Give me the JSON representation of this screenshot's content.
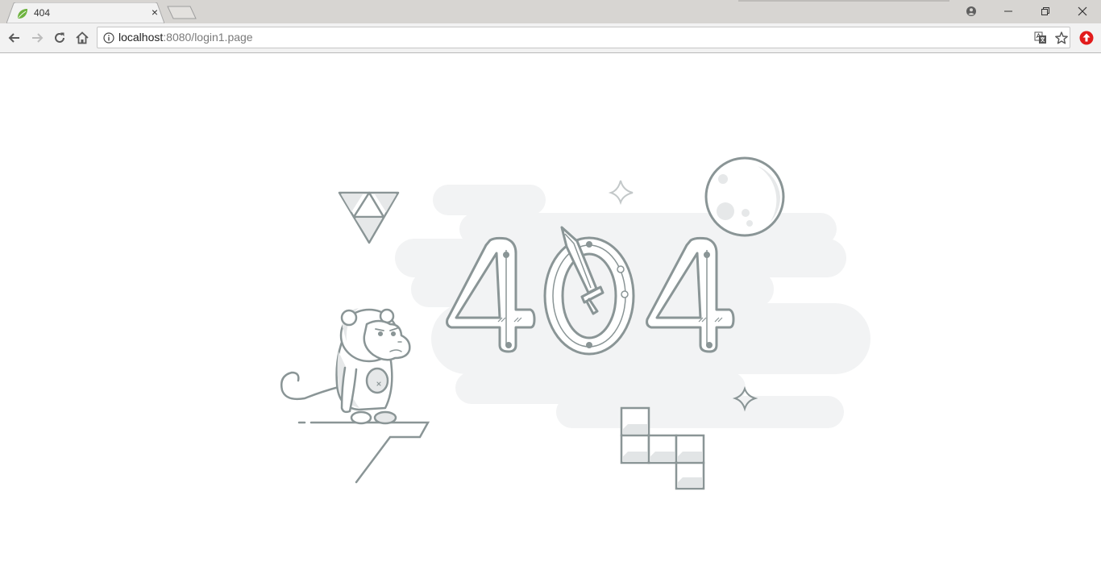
{
  "browser": {
    "tab": {
      "title": "404",
      "favicon": "spring-leaf-icon",
      "close_label": "×"
    },
    "toolbar": {
      "url_host": "localhost",
      "url_rest": ":8080/login1.page"
    }
  },
  "page": {
    "error_code": "404"
  },
  "colors": {
    "stroke": "#8a9596",
    "cloud": "#f2f3f4",
    "tabstrip": "#d7d5d2",
    "leaf": "#6db33f",
    "ext_red": "#e21b1b"
  }
}
